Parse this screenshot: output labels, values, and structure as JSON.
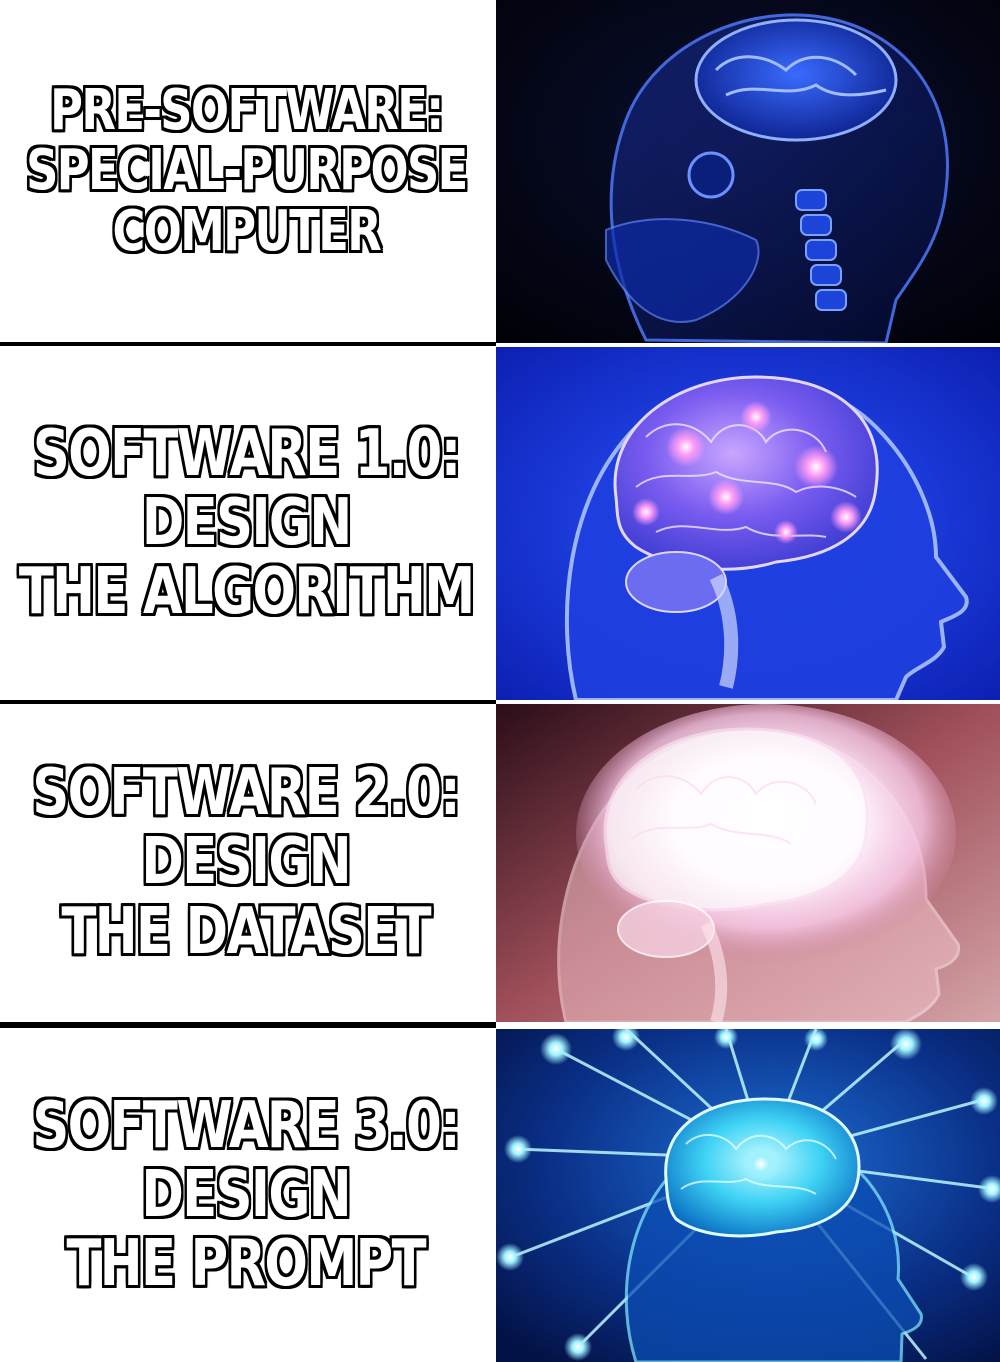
{
  "panels": [
    {
      "caption_lines": [
        "PRE-SOFTWARE:",
        "SPECIAL-PURPOSE",
        "COMPUTER"
      ],
      "image": "dim-blue-brain-skull"
    },
    {
      "caption_lines": [
        "SOFTWARE 1.0:",
        "DESIGN",
        "THE ALGORITHM"
      ],
      "image": "glowing-purple-brain-head"
    },
    {
      "caption_lines": [
        "SOFTWARE 2.0:",
        "DESIGN",
        "THE DATASET"
      ],
      "image": "radiant-white-brain-head"
    },
    {
      "caption_lines": [
        "SOFTWARE 3.0:",
        "DESIGN",
        "THE PROMPT"
      ],
      "image": "cosmic-beaming-brain-head"
    }
  ],
  "colors": {
    "caption_fill": "#ffffff",
    "caption_outline": "#000000",
    "divider": "#000000"
  }
}
